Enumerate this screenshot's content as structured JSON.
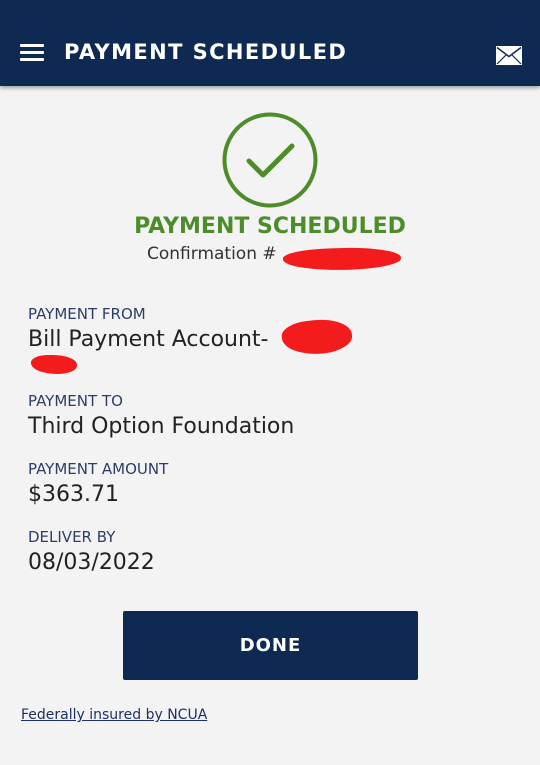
{
  "header": {
    "title": "PAYMENT SCHEDULED",
    "menu_icon": "hamburger-menu-icon",
    "mail_icon": "envelope-icon"
  },
  "status": {
    "icon": "check-circle-icon",
    "title": "PAYMENT SCHEDULED",
    "confirmation_label": "Confirmation #"
  },
  "details": {
    "payment_from": {
      "label": "PAYMENT FROM",
      "value": "Bill Payment Account-"
    },
    "payment_to": {
      "label": "PAYMENT TO",
      "value": "Third Option Foundation"
    },
    "payment_amount": {
      "label": "PAYMENT AMOUNT",
      "value": "$363.71"
    },
    "deliver_by": {
      "label": "DELIVER BY",
      "value": "08/03/2022"
    }
  },
  "actions": {
    "done_label": "DONE"
  },
  "footer": {
    "ncua_link": "Federally insured by NCUA"
  },
  "colors": {
    "header_bg": "#0e2a53",
    "success_green": "#4d8d29",
    "label_blue": "#2c3e66",
    "redaction_red": "#f31b1b"
  }
}
